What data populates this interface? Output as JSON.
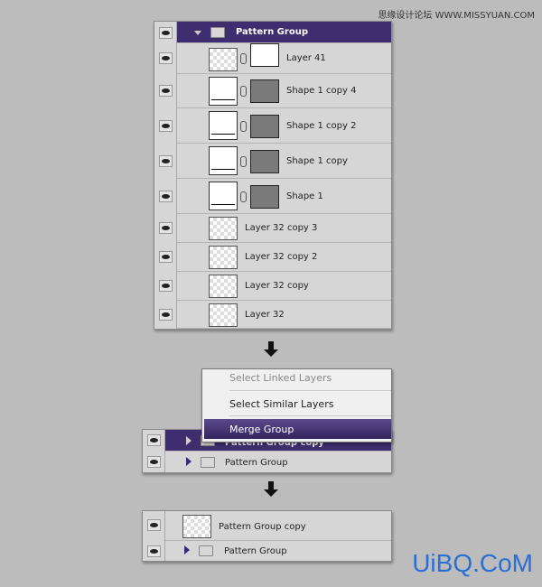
{
  "watermark_top": "思缘设计论坛 WWW.MISSYUAN.COM",
  "watermark_bottom": "UiBQ.CoM",
  "panel1": {
    "group": "Pattern Group",
    "layers": [
      {
        "name": "Layer 41",
        "type": "masked"
      },
      {
        "name": "Shape 1 copy 4",
        "type": "shape"
      },
      {
        "name": "Shape 1 copy 2",
        "type": "shape"
      },
      {
        "name": "Shape 1 copy",
        "type": "shape"
      },
      {
        "name": "Shape 1",
        "type": "shape"
      },
      {
        "name": "Layer 32 copy 3",
        "type": "pixel"
      },
      {
        "name": "Layer 32 copy 2",
        "type": "pixel"
      },
      {
        "name": "Layer 32 copy",
        "type": "pixel"
      },
      {
        "name": "Layer 32",
        "type": "pixel"
      }
    ]
  },
  "menu": {
    "items": [
      "Select Linked Layers",
      "Select Similar Layers",
      "Merge Group"
    ],
    "highlighted": "Merge Group"
  },
  "panel2": {
    "rows": [
      "Pattern Group copy",
      "Pattern Group"
    ]
  },
  "panel3": {
    "rows": [
      "Pattern Group copy",
      "Pattern Group"
    ]
  },
  "colors": {
    "selection": "#3f2e6f",
    "watermark": "#2a6fd6"
  }
}
